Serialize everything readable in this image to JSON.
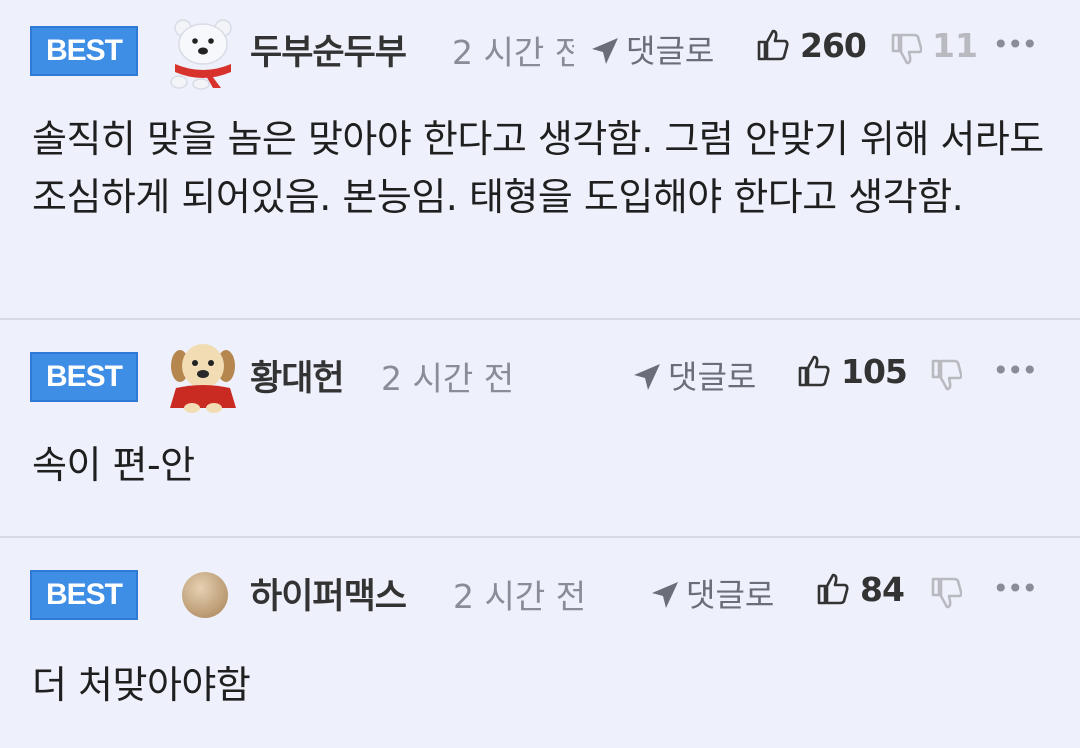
{
  "comments": [
    {
      "badge": "BEST",
      "avatar": "polar-bear-with-red-scarf",
      "nickname": "두부순두부",
      "time": "2 시간 전",
      "reply_label": "댓글로",
      "likes": "260",
      "dislikes": "11",
      "more": "•••",
      "body": "솔직히 맞을 놈은 맞아야 한다고 생각함. 그럼 안맞기 위해 서라도 조심하게 되어있음. 본능임. 태형을 도입해야 한다고 생각함."
    },
    {
      "badge": "BEST",
      "avatar": "puppy-with-red-cape",
      "nickname": "황대헌",
      "time": "2 시간 전",
      "reply_label": "댓글로",
      "likes": "105",
      "dislikes": "",
      "more": "•••",
      "body": "속이 편-안"
    },
    {
      "badge": "BEST",
      "avatar": "beige-circle",
      "nickname": "하이퍼맥스",
      "time": "2 시간 전",
      "reply_label": "댓글로",
      "likes": "84",
      "dislikes": "",
      "more": "•••",
      "body": "더 처맞아야함"
    }
  ],
  "colors": {
    "background": "#eef1fb",
    "badge": "#3f8ee6",
    "divider": "#d6d9e3"
  }
}
